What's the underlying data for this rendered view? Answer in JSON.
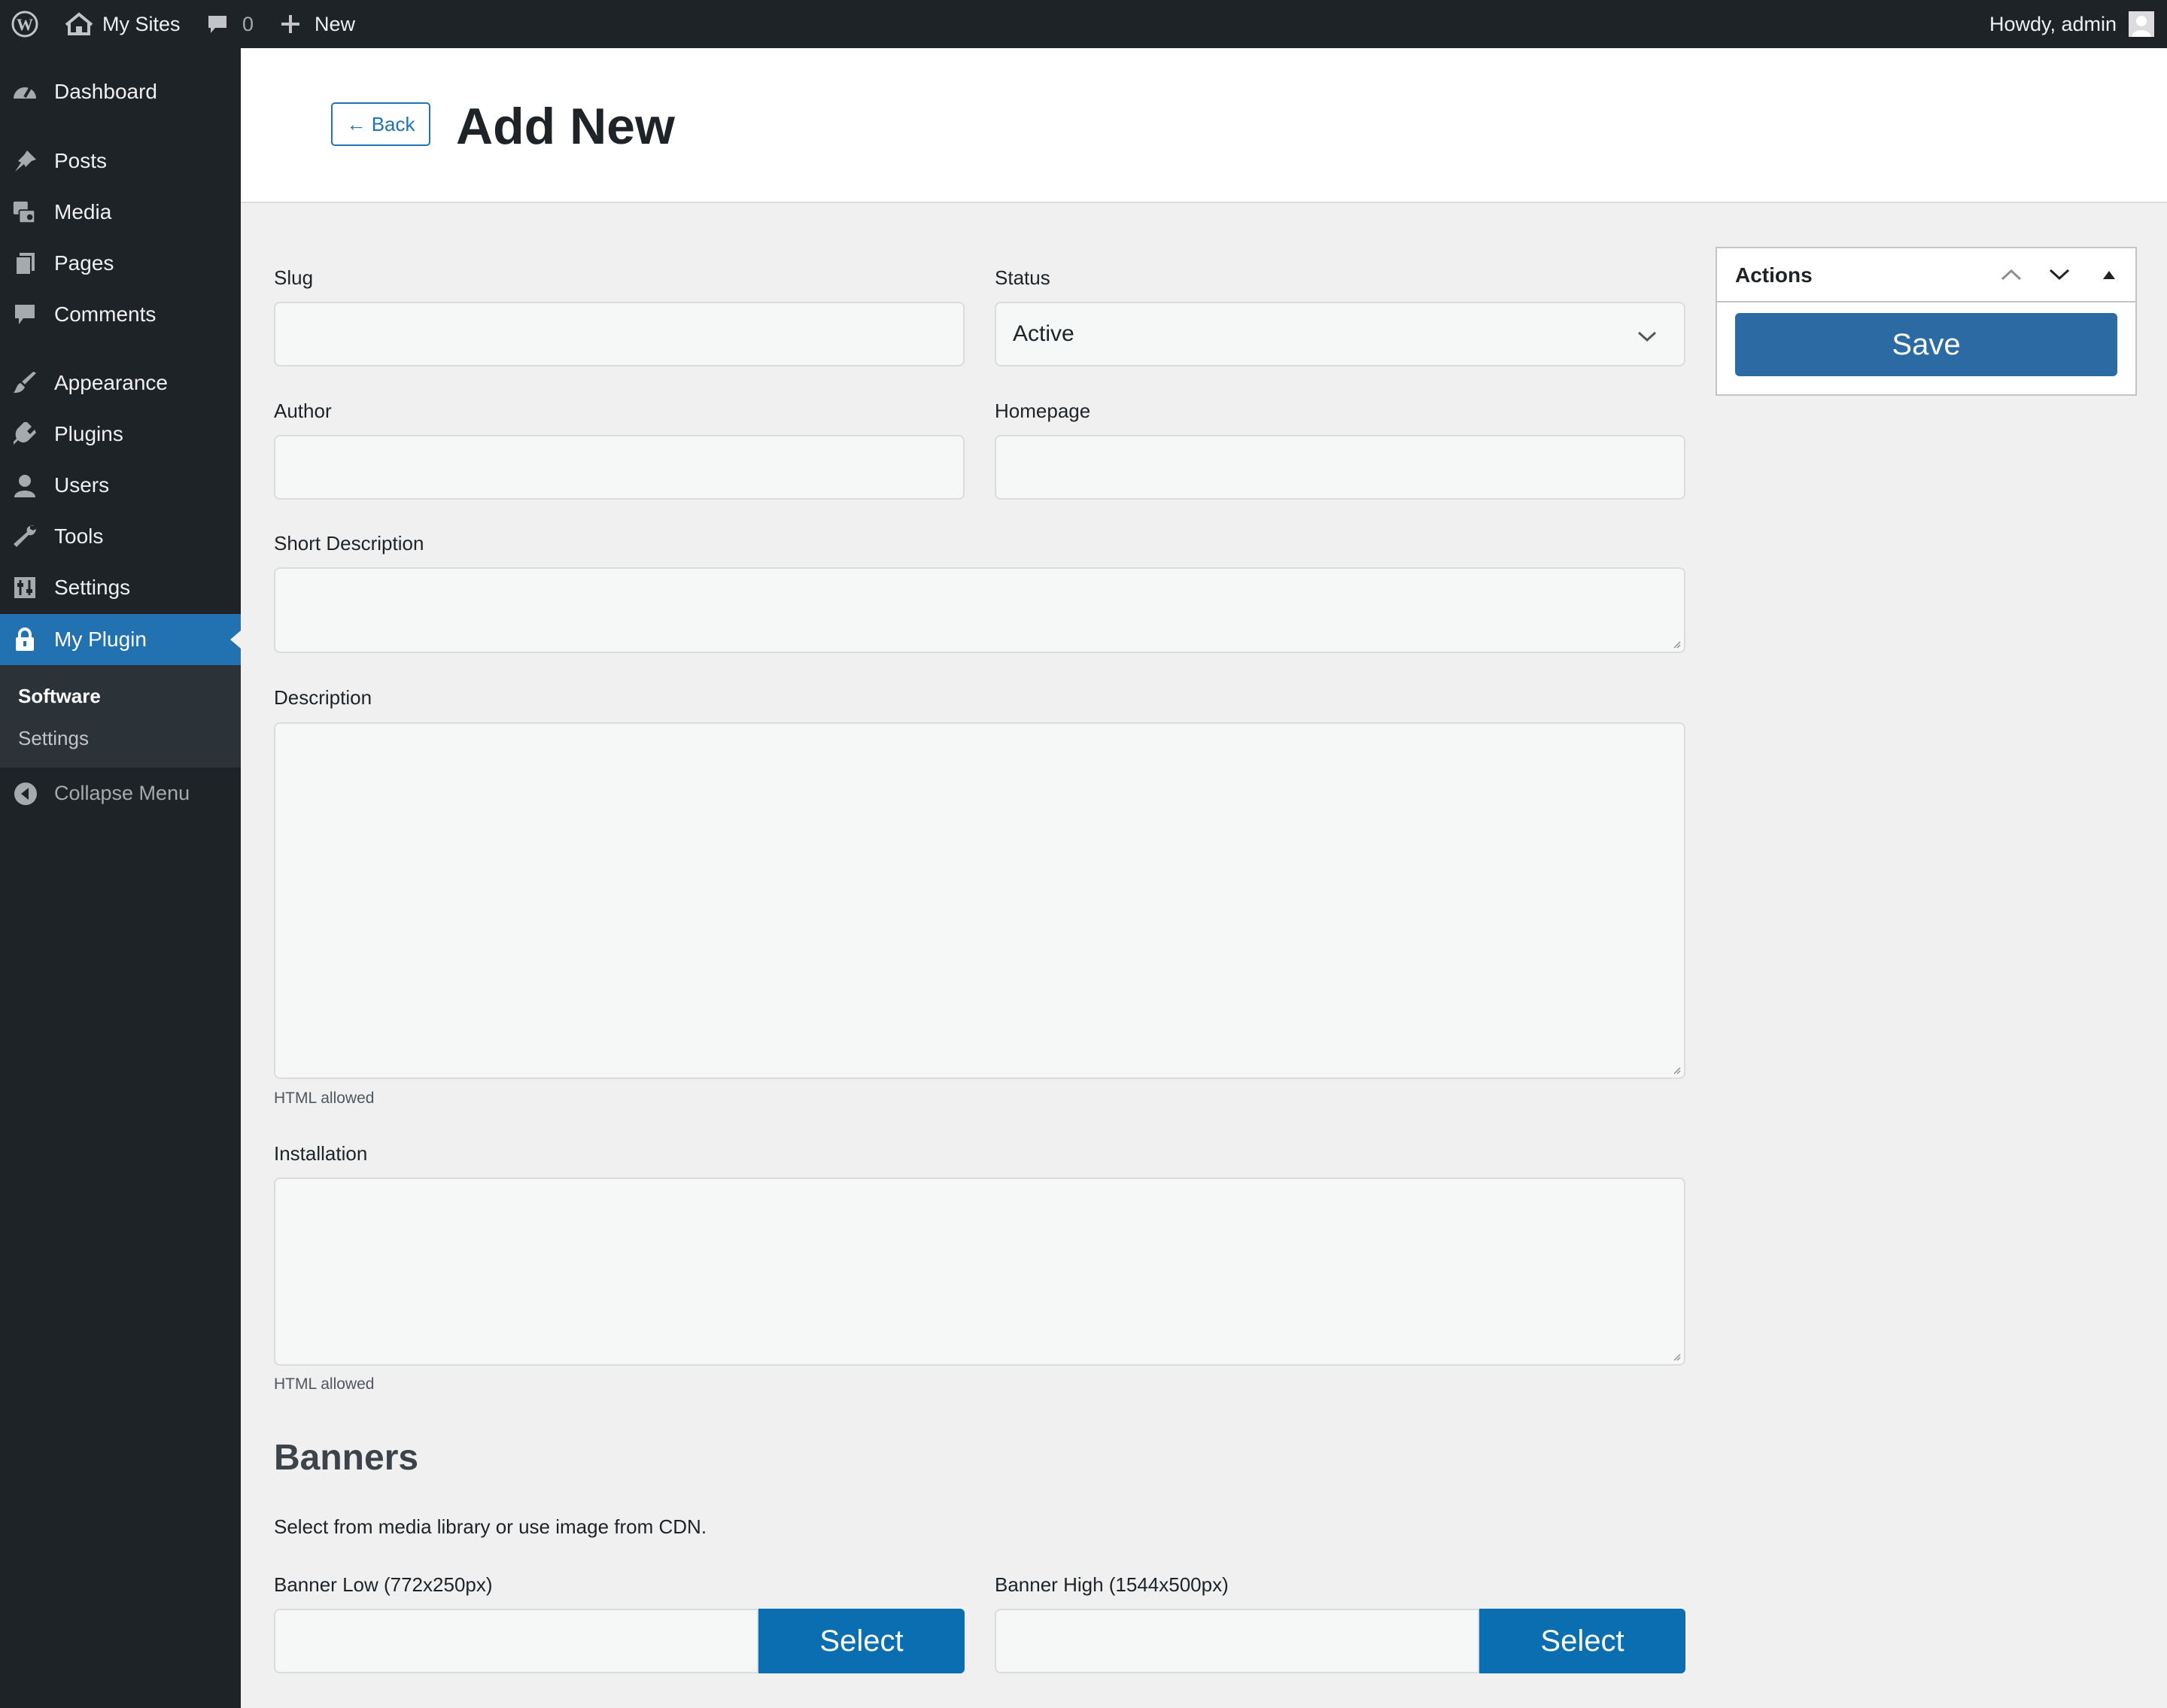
{
  "adminbar": {
    "my_sites": "My Sites",
    "comments_count": "0",
    "new_label": "New",
    "howdy": "Howdy, admin"
  },
  "sidebar": {
    "items": [
      {
        "label": "Dashboard",
        "icon": "dashboard-icon"
      },
      {
        "label": "Posts",
        "icon": "pin-icon"
      },
      {
        "label": "Media",
        "icon": "media-icon"
      },
      {
        "label": "Pages",
        "icon": "pages-icon"
      },
      {
        "label": "Comments",
        "icon": "comment-icon"
      },
      {
        "label": "Appearance",
        "icon": "brush-icon"
      },
      {
        "label": "Plugins",
        "icon": "plug-icon"
      },
      {
        "label": "Users",
        "icon": "user-icon"
      },
      {
        "label": "Tools",
        "icon": "wrench-icon"
      },
      {
        "label": "Settings",
        "icon": "sliders-icon"
      },
      {
        "label": "My Plugin",
        "icon": "lock-icon"
      }
    ],
    "submenu": [
      {
        "label": "Software"
      },
      {
        "label": "Settings"
      }
    ],
    "collapse": "Collapse Menu",
    "active_color": "#2271b1"
  },
  "header": {
    "back": "← Back",
    "title": "Add New"
  },
  "form": {
    "slug_label": "Slug",
    "status_label": "Status",
    "status_value": "Active",
    "author_label": "Author",
    "homepage_label": "Homepage",
    "short_desc_label": "Short Description",
    "description_label": "Description",
    "description_help": "HTML allowed",
    "installation_label": "Installation",
    "installation_help": "HTML allowed"
  },
  "banners": {
    "title": "Banners",
    "description": "Select from media library or use image from CDN.",
    "low_label": "Banner Low (772x250px)",
    "high_label": "Banner High (1544x500px)",
    "select_label": "Select"
  },
  "actions": {
    "title": "Actions",
    "save": "Save"
  }
}
